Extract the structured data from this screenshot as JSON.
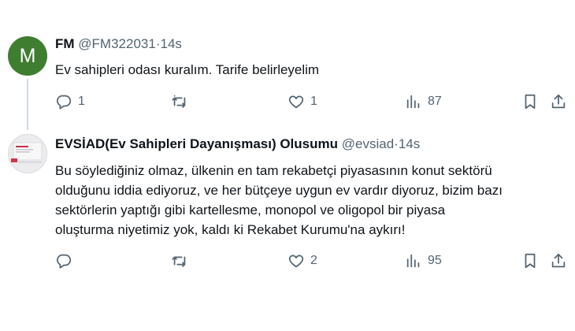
{
  "tweets": [
    {
      "avatar_letter": "M",
      "avatar_color": "#3f7d31",
      "name": "FM",
      "handle": "@FM322031",
      "separator": "·",
      "time": "14s",
      "text": "Ev sahipleri odası kuralım. Tarife belirleyelim",
      "reply_count": "1",
      "retweet_count": "",
      "like_count": "1",
      "views_count": "87"
    },
    {
      "name": "EVSİAD(Ev Sahipleri Dayanışması) Olusumu",
      "handle": "@evsiad",
      "separator": "·",
      "time": "14s",
      "text_lines": [
        "Bu söylediğiniz olmaz, ülkenin en tam rekabetçi piyasasının konut sektörü",
        "olduğunu iddia ediyoruz, ve her bütçeye uygun ev vardır diyoruz, bizim bazı",
        "sektörlerin yaptığı gibi kartellesme, monopol ve oligopol bir piyasa",
        "oluşturma niyetimiz yok, kaldı ki Rekabet Kurumu'na aykırı!"
      ],
      "reply_count": "",
      "retweet_count": "",
      "like_count": "2",
      "views_count": "95"
    }
  ],
  "icons": {
    "reply": "reply-icon",
    "retweet": "retweet-icon",
    "like": "heart-icon",
    "views": "views-icon",
    "bookmark": "bookmark-icon",
    "share": "share-icon"
  },
  "colors": {
    "text": "#0f1419",
    "secondary": "#536471",
    "thread_line": "#cfd9de"
  }
}
